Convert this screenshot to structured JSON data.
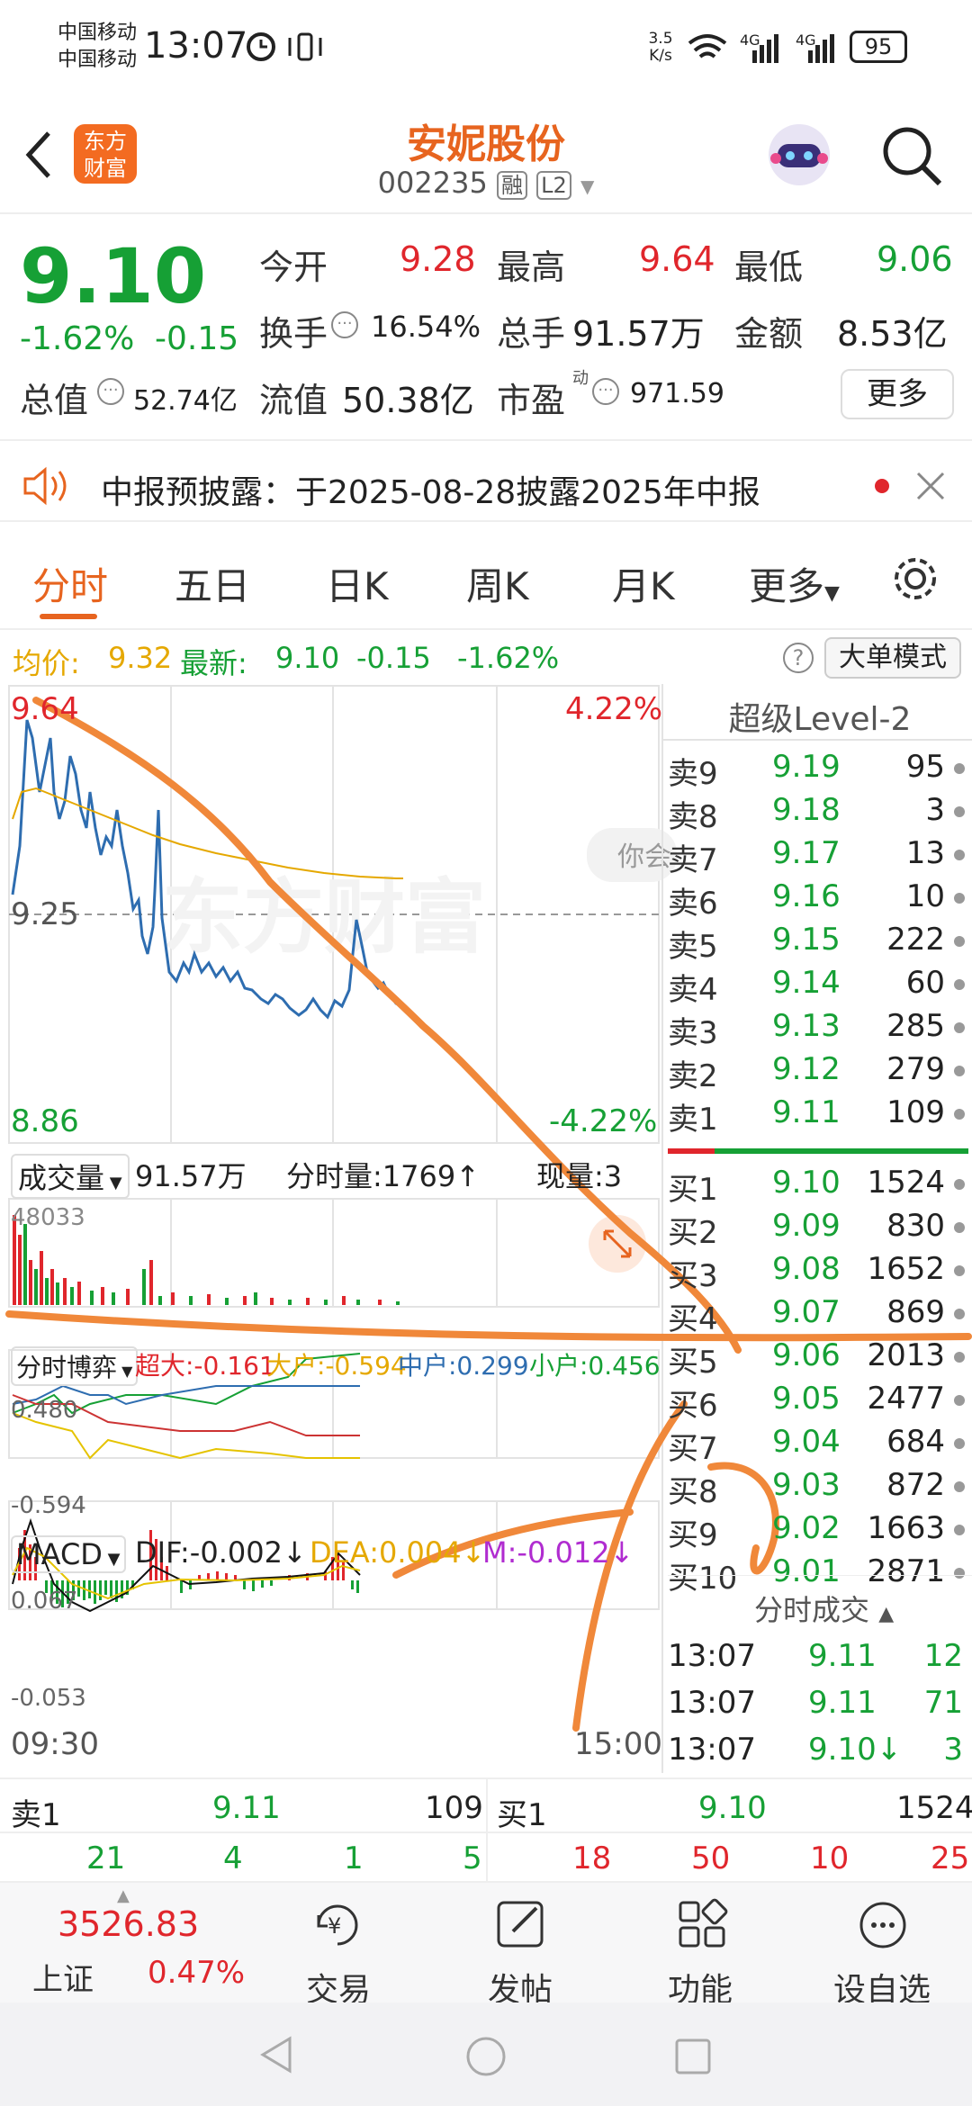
{
  "status": {
    "carrier1": "中国移动",
    "carrier2": "中国移动",
    "time": "13:07",
    "net_speed": "3.5 K/s",
    "battery": "95"
  },
  "header": {
    "logo": "东方财富",
    "title": "安妮股份",
    "code": "002235",
    "badge1": "融",
    "badge2": "L2"
  },
  "quote": {
    "price": "9.10",
    "change_pct": "-1.62%",
    "change": "-0.15",
    "open_label": "今开",
    "open": "9.28",
    "high_label": "最高",
    "high": "9.64",
    "low_label": "最低",
    "low": "9.06",
    "turnover_label": "换手",
    "turnover": "16.54%",
    "vol_label": "总手",
    "vol": "91.57万",
    "amount_label": "金额",
    "amount": "8.53亿",
    "mcap_label": "总值",
    "mcap": "52.74亿",
    "float_label": "流值",
    "float": "50.38亿",
    "pe_label": "市盈",
    "pe_sup": "动",
    "pe": "971.59",
    "more": "更多"
  },
  "notice": {
    "text": "中报预披露：于2025-08-28披露2025年中报"
  },
  "tabs": {
    "t1": "分时",
    "t2": "五日",
    "t3": "日K",
    "t4": "周K",
    "t5": "月K",
    "t6": "更多"
  },
  "infobar": {
    "avg_label": "均价:",
    "avg": "9.32",
    "latest_label": "最新:",
    "latest": "9.10",
    "chg": "-0.15",
    "pct": "-1.62%",
    "mode": "大单模式"
  },
  "chart": {
    "top": "9.64",
    "mid": "9.25",
    "bottom": "8.86",
    "pct_top": "4.22%",
    "pct_bottom": "-4.22%",
    "watermark": "东方财富",
    "start": "09:30",
    "end": "15:00",
    "bubble": "你会"
  },
  "level2": {
    "title": "超级Level-2"
  },
  "asks": [
    {
      "label": "卖9",
      "price": "9.19",
      "vol": "95"
    },
    {
      "label": "卖8",
      "price": "9.18",
      "vol": "3"
    },
    {
      "label": "卖7",
      "price": "9.17",
      "vol": "13"
    },
    {
      "label": "卖6",
      "price": "9.16",
      "vol": "10"
    },
    {
      "label": "卖5",
      "price": "9.15",
      "vol": "222"
    },
    {
      "label": "卖4",
      "price": "9.14",
      "vol": "60"
    },
    {
      "label": "卖3",
      "price": "9.13",
      "vol": "285"
    },
    {
      "label": "卖2",
      "price": "9.12",
      "vol": "279"
    },
    {
      "label": "卖1",
      "price": "9.11",
      "vol": "109"
    }
  ],
  "bids": [
    {
      "label": "买1",
      "price": "9.10",
      "vol": "1524"
    },
    {
      "label": "买2",
      "price": "9.09",
      "vol": "830"
    },
    {
      "label": "买3",
      "price": "9.08",
      "vol": "1652"
    },
    {
      "label": "买4",
      "price": "9.07",
      "vol": "869"
    },
    {
      "label": "买5",
      "price": "9.06",
      "vol": "2013"
    },
    {
      "label": "买6",
      "price": "9.05",
      "vol": "2477"
    },
    {
      "label": "买7",
      "price": "9.04",
      "vol": "684"
    },
    {
      "label": "买8",
      "price": "9.03",
      "vol": "872"
    },
    {
      "label": "买9",
      "price": "9.02",
      "vol": "1663"
    },
    {
      "label": "买10",
      "price": "9.01",
      "vol": "2871"
    }
  ],
  "trades": {
    "title": "分时成交",
    "rows": [
      {
        "time": "13:07",
        "price": "9.11",
        "vol": "12"
      },
      {
        "time": "13:07",
        "price": "9.11",
        "vol": "71"
      },
      {
        "time": "13:07",
        "price": "9.10↓",
        "vol": "3"
      }
    ]
  },
  "volume": {
    "label": "成交量",
    "total": "91.57万",
    "minute": "分时量:1769↑",
    "now": "现量:3",
    "max": "48033"
  },
  "game": {
    "label": "分时博弈",
    "super": "超大:-0.161",
    "big": "大户:-0.594",
    "mid": "中户:0.299",
    "small": "小户:0.456",
    "top": "0.480",
    "bottom": "-0.594"
  },
  "macd": {
    "label": "MACD",
    "dif": "DIF:-0.002↓",
    "dea": "DEA:0.004↓",
    "m": "M:-0.012↓",
    "top": "0.067",
    "bottom": "-0.053"
  },
  "bottom": {
    "ask_label": "卖1",
    "ask_price": "9.11",
    "ask_vol": "109",
    "bid_label": "买1",
    "bid_price": "9.10",
    "bid_vol": "1524",
    "g1": [
      "21",
      "4",
      "1",
      "5"
    ],
    "g2": [
      "18",
      "50",
      "10",
      "25"
    ]
  },
  "nav": {
    "index": "3526.83",
    "index_name": "上证",
    "index_pct": "0.47%",
    "trade": "交易",
    "post": "发帖",
    "func": "功能",
    "watch": "设自选"
  }
}
